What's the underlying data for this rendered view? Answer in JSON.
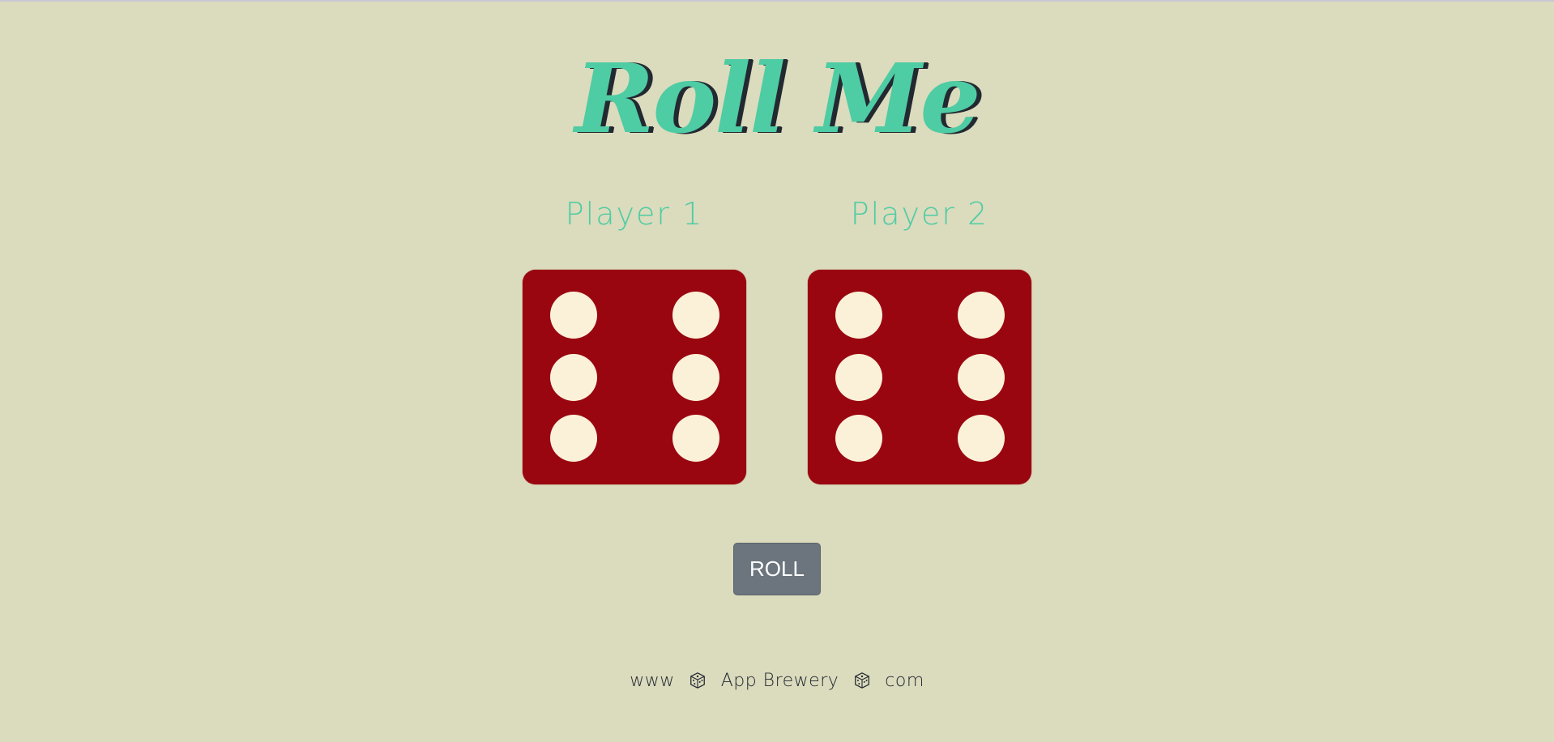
{
  "title": "Roll Me",
  "players": [
    {
      "label": "Player 1",
      "die_value": 6
    },
    {
      "label": "Player 2",
      "die_value": 6
    }
  ],
  "colors": {
    "background": "#DBDBBD",
    "accent": "#4ECCA3",
    "die_face": "#9A0610",
    "pip": "#FBF1D9",
    "button": "#6C757D"
  },
  "roll_button": {
    "label": "ROLL"
  },
  "footer": {
    "part1": "www",
    "part2": "App Brewery",
    "part3": "com",
    "separator_icon": "dice-icon"
  }
}
